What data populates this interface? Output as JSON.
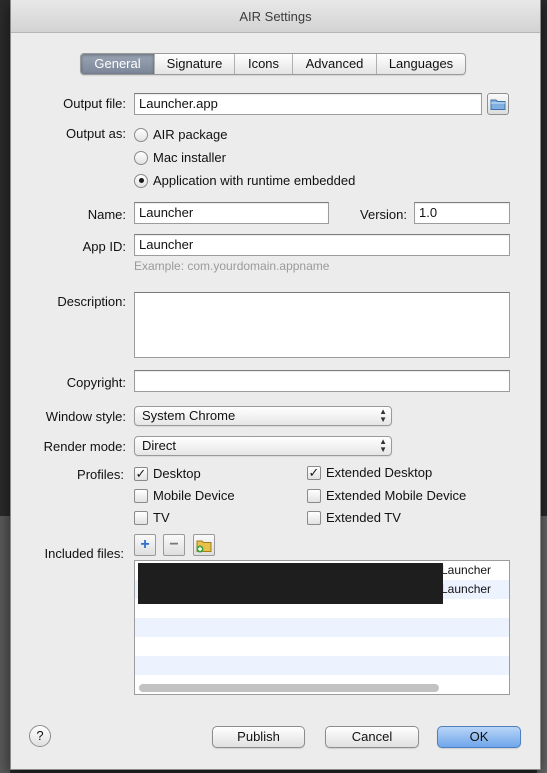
{
  "window": {
    "title": "AIR Settings"
  },
  "tabs": [
    "General",
    "Signature",
    "Icons",
    "Advanced",
    "Languages"
  ],
  "output_file": {
    "label": "Output file:",
    "value": "Launcher.app"
  },
  "output_as": {
    "label": "Output as:",
    "options": [
      "AIR package",
      "Mac installer",
      "Application with runtime embedded"
    ],
    "selected": "Application with runtime embedded"
  },
  "name": {
    "label": "Name:",
    "value": "Launcher"
  },
  "version": {
    "label": "Version:",
    "value": "1.0"
  },
  "app_id": {
    "label": "App ID:",
    "value": "Launcher",
    "hint": "Example: com.yourdomain.appname"
  },
  "description": {
    "label": "Description:",
    "value": ""
  },
  "copyright": {
    "label": "Copyright:",
    "value": ""
  },
  "window_style": {
    "label": "Window style:",
    "value": "System Chrome"
  },
  "render_mode": {
    "label": "Render mode:",
    "value": "Direct"
  },
  "profiles": {
    "label": "Profiles:",
    "items": [
      {
        "label": "Desktop",
        "checked": true
      },
      {
        "label": "Extended Desktop",
        "checked": true
      },
      {
        "label": "Mobile Device",
        "checked": false
      },
      {
        "label": "Extended Mobile Device",
        "checked": false
      },
      {
        "label": "TV",
        "checked": false
      },
      {
        "label": "Extended TV",
        "checked": false
      }
    ]
  },
  "included_files": {
    "label": "Included files:",
    "rows": [
      "Launcher",
      "Launcher"
    ],
    "glyphs": {
      "add": "+",
      "remove": "−"
    }
  },
  "buttons": {
    "help": "?",
    "publish": "Publish",
    "cancel": "Cancel",
    "ok": "OK"
  },
  "icons": {
    "folder": "folder-icon",
    "add": "plus-icon",
    "remove": "minus-icon",
    "add_folder": "add-folder-icon"
  },
  "colors": {
    "primary_button": "#6fa6ea",
    "active_tab": "#7b8799",
    "stripe": "#edf3fe"
  }
}
